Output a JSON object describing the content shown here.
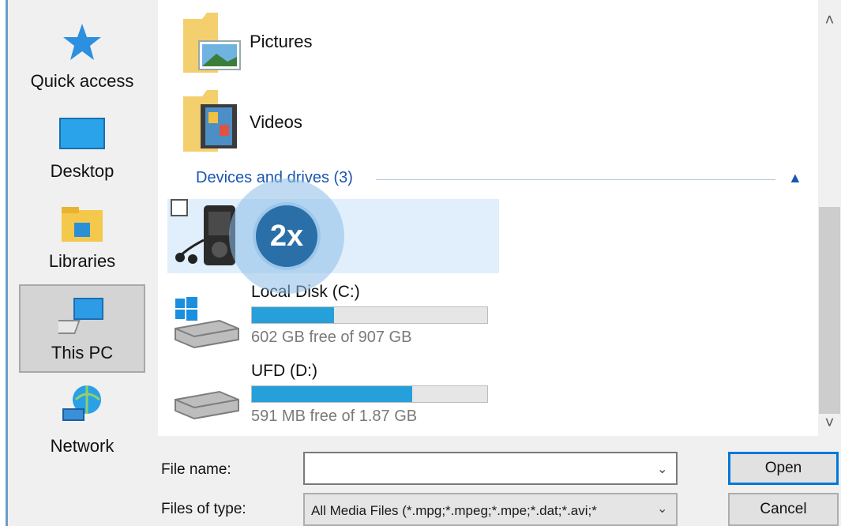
{
  "sidebar": {
    "items": [
      {
        "label": "Quick access",
        "icon": "star-icon",
        "selected": false
      },
      {
        "label": "Desktop",
        "icon": "desktop-icon",
        "selected": false
      },
      {
        "label": "Libraries",
        "icon": "libraries-icon",
        "selected": false
      },
      {
        "label": "This PC",
        "icon": "computer-icon",
        "selected": true
      },
      {
        "label": "Network",
        "icon": "network-icon",
        "selected": false
      }
    ]
  },
  "folders": [
    {
      "name": "Pictures",
      "icon": "pictures-folder-icon"
    },
    {
      "name": "Videos",
      "icon": "videos-folder-icon"
    }
  ],
  "devices_group": {
    "header": "Devices and drives (3)",
    "device_icon": "media-player-icon",
    "drives": [
      {
        "name": "Local Disk (C:)",
        "free_text": "602 GB free of 907 GB",
        "used_fraction": 0.35,
        "icon": "windows-drive-icon"
      },
      {
        "name": "UFD (D:)",
        "free_text": "591 MB free of 1.87 GB",
        "used_fraction": 0.68,
        "icon": "usb-drive-icon"
      }
    ]
  },
  "overlay": {
    "badge_text": "2x"
  },
  "bottom": {
    "file_name_label": "File name:",
    "file_name_value": "",
    "files_of_type_label": "Files of type:",
    "files_of_type_value": "All Media Files (*.mpg;*.mpeg;*.mpe;*.dat;*.avi;*",
    "open_label": "Open",
    "cancel_label": "Cancel"
  },
  "colors": {
    "accent": "#26a0da",
    "group_header": "#1a56b0",
    "selection": "#e1effc"
  }
}
